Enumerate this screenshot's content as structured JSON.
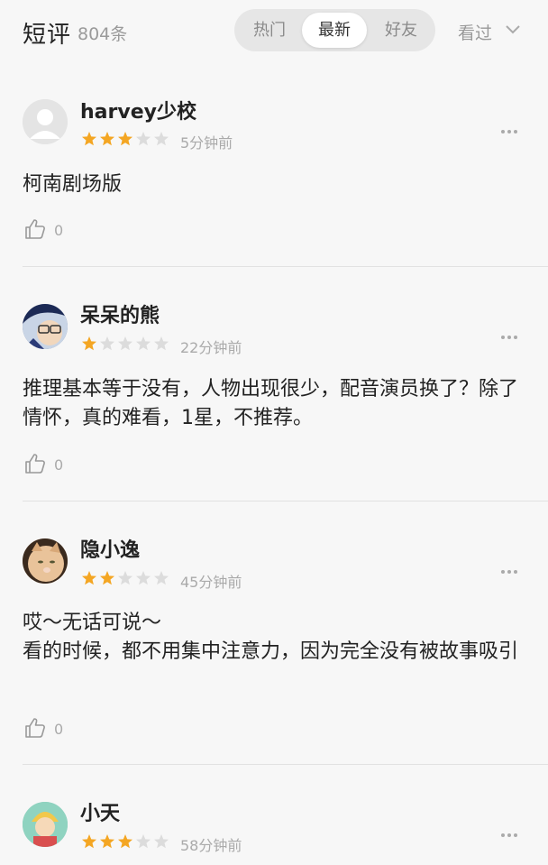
{
  "header": {
    "title": "短评",
    "count": "804条",
    "tabs": [
      "热门",
      "最新",
      "好友"
    ],
    "active_tab": "最新",
    "filter_label": "看过"
  },
  "colors": {
    "star_on": "#f4a623",
    "star_off": "#dcdcdc",
    "divider": "#e2e2e2"
  },
  "reviews": [
    {
      "username": "harvey少校",
      "rating": 3,
      "time": "5分钟前",
      "content": "柯南剧场版",
      "likes": "0"
    },
    {
      "username": "呆呆的熊",
      "rating": 1,
      "time": "22分钟前",
      "content": "推理基本等于没有，人物出现很少，配音演员换了？除了情怀，真的难看，1星，不推荐。",
      "likes": "0"
    },
    {
      "username": "隐小逸",
      "rating": 2,
      "time": "45分钟前",
      "content": "哎～无话可说～\n看的时候，都不用集中注意力，因为完全没有被故事吸引",
      "likes": "0"
    },
    {
      "username": "小天",
      "rating": 3,
      "time": "58分钟前",
      "content": "",
      "likes": ""
    }
  ]
}
